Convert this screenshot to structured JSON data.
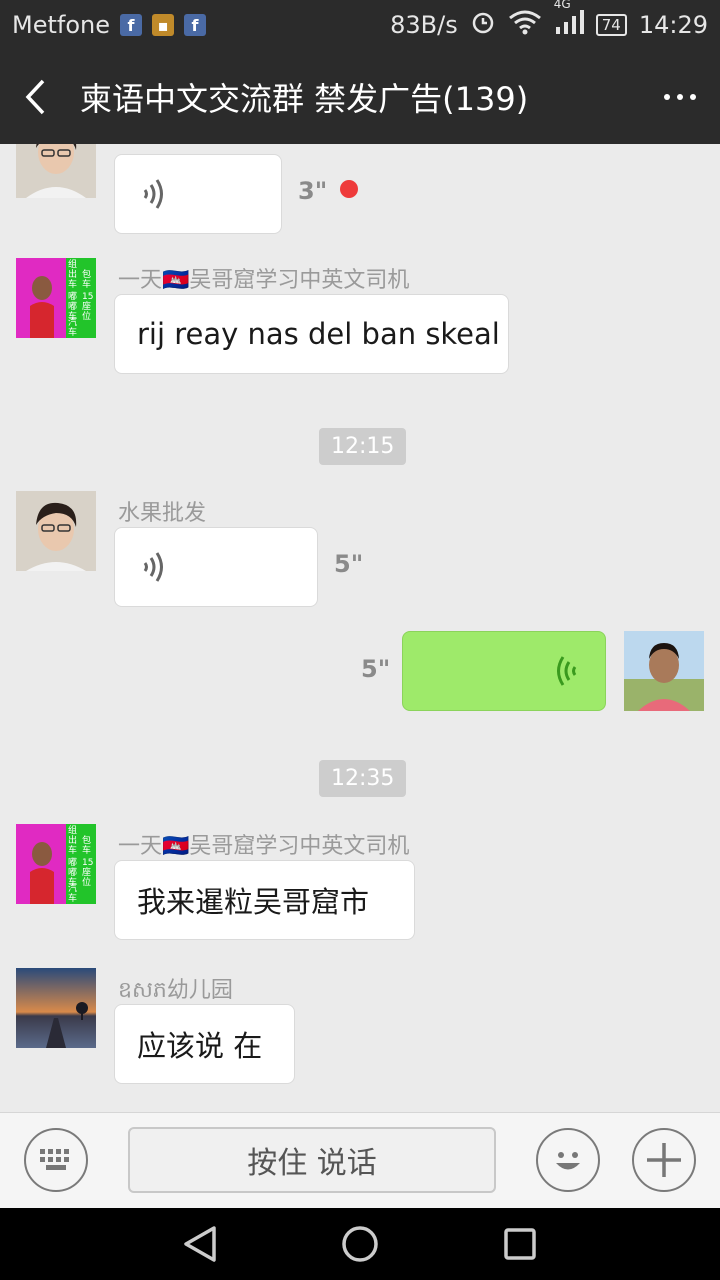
{
  "status_bar": {
    "carrier": "Metfone",
    "speed": "83B/s",
    "network": "4G",
    "battery": "74",
    "time": "14:29"
  },
  "header": {
    "title": "柬语中文交流群  禁发广告(139)"
  },
  "messages": [
    {
      "sender": "",
      "type": "voice",
      "duration": "3\""
    },
    {
      "sender": "一天🇰🇭吴哥窟学习中英文司机",
      "type": "text",
      "text": "rij reay nas del ban skeal"
    },
    {
      "sender": "水果批发",
      "type": "voice",
      "duration": "5\""
    },
    {
      "sender": "",
      "type": "voice",
      "duration": "5\""
    },
    {
      "sender": "一天🇰🇭吴哥窟学习中英文司机",
      "type": "text",
      "text": "我来暹粒吴哥窟市"
    },
    {
      "sender": "ឧសភ幼儿园",
      "type": "text",
      "text": "应该说 在"
    }
  ],
  "time_labels": [
    "12:15",
    "12:35"
  ],
  "input_bar": {
    "hold_to_talk": "按住 说话"
  },
  "avatar_badge": [
    "组出车",
    "嘟嘟车",
    "包车",
    "15座位",
    "汽车"
  ],
  "colors": {
    "header_bg": "#2b2b2b",
    "chat_bg": "#ebebeb",
    "sent_bubble": "#9eea6a",
    "unread_dot": "#ee3a3a"
  }
}
